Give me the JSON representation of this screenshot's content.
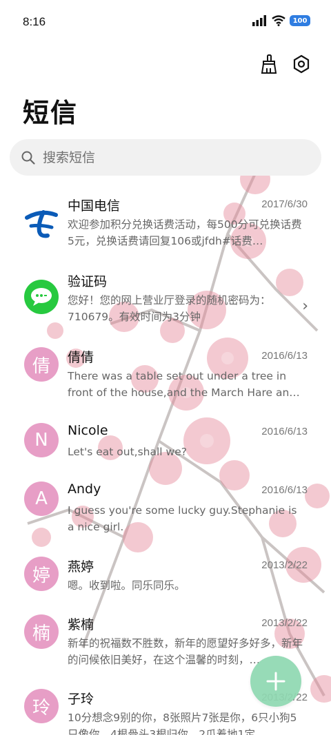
{
  "status": {
    "time": "8:16",
    "battery": "100"
  },
  "header": {
    "title": "短信"
  },
  "search": {
    "placeholder": "搜索短信"
  },
  "conversations": [
    {
      "name": "中国电信",
      "date": "2017/6/30",
      "preview": "欢迎参加积分兑换话费活动，每500分可兑换话费5元，兑换话费请回复106或jfdh#话费…",
      "avatar": "telecom-logo"
    },
    {
      "name": "验证码",
      "date": "",
      "preview": "您好！您的网上营业厅登录的随机密码为：710679。有效时间为3分钟",
      "avatar": "message-icon"
    },
    {
      "name": "倩倩",
      "date": "2016/6/13",
      "preview": "There was a table set out under a tree in front of the house,and the March Hare an…",
      "letter": "倩"
    },
    {
      "name": "Nicole",
      "date": "2016/6/13",
      "preview": "Let's eat out,shall we?",
      "letter": "N"
    },
    {
      "name": "Andy",
      "date": "2016/6/13",
      "preview": "I guess you're some lucky guy.Stephanie is a nice girl.",
      "letter": "A"
    },
    {
      "name": "燕婷",
      "date": "2013/2/22",
      "preview": "嗯。收到啦。同乐同乐。",
      "letter": "婷"
    },
    {
      "name": "紫楠",
      "date": "2013/2/22",
      "preview": "新年的祝福数不胜数，新年的愿望好多好多，新年的问候依旧美好，在这个温馨的时刻，…",
      "letter": "楠"
    },
    {
      "name": "子玲",
      "date": "2013/2/22",
      "preview": "10分想念9别的你，8张照片7张是你，6只小狗5只像你，4根骨头3根归你，2爪着地1定…",
      "letter": "玲"
    }
  ],
  "colors": {
    "avatar": "#e79ec6",
    "fab": "#8fd8b1",
    "battery": "#2f7de1",
    "telecom": "#0b5bb7",
    "message_icon": "#27c93f"
  }
}
